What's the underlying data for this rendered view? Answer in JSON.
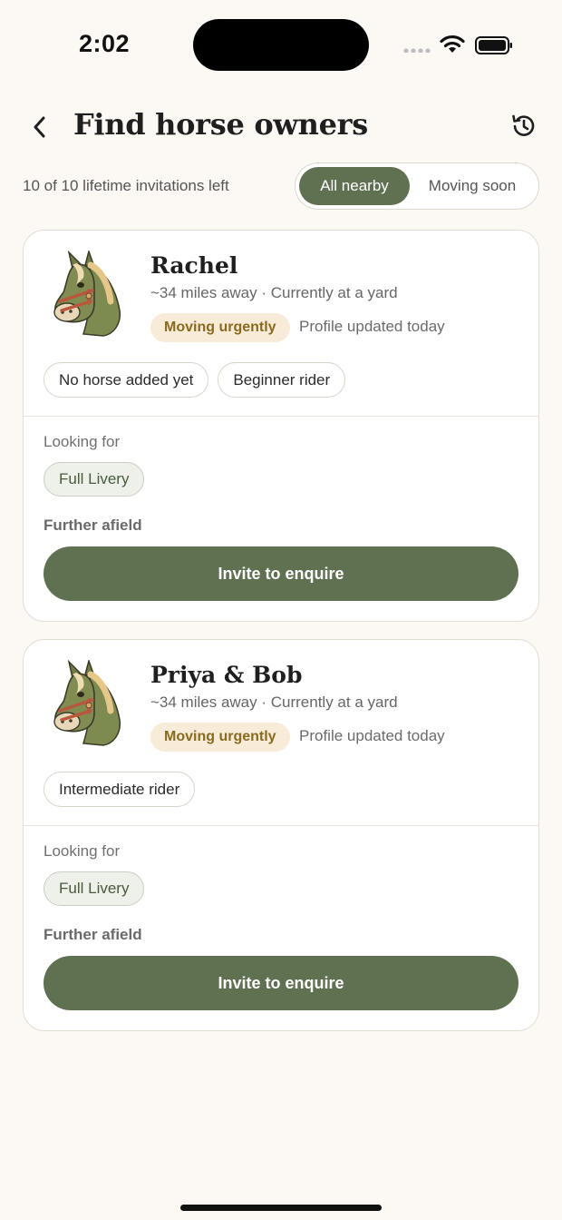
{
  "status_bar": {
    "time": "2:02",
    "icons": [
      "signal-icon",
      "wifi-icon",
      "battery-icon"
    ]
  },
  "header": {
    "title": "Find horse owners",
    "back_icon": "chevron-left-icon",
    "history_icon": "history-icon"
  },
  "controls": {
    "invites_left": "10 of 10 lifetime invitations left",
    "filters": [
      {
        "label": "All nearby",
        "selected": true
      },
      {
        "label": "Moving soon",
        "selected": false
      }
    ]
  },
  "colors": {
    "accent": "#5f7151",
    "background": "#fcf9f5",
    "badge_bg": "#f8ecd8",
    "badge_text": "#8a6a1f"
  },
  "owners": [
    {
      "name": "Rachel",
      "meta": "~34 miles away · Currently at a yard",
      "badge": "Moving urgently",
      "updated": "Profile updated today",
      "chips": [
        "No horse added yet",
        "Beginner rider"
      ],
      "looking_for_label": "Looking for",
      "looking_for": "Full Livery",
      "further_label": "Further afield",
      "cta": "Invite to enquire"
    },
    {
      "name": "Priya & Bob",
      "meta": "~34 miles away · Currently at a yard",
      "badge": "Moving urgently",
      "updated": "Profile updated today",
      "chips": [
        "Intermediate rider"
      ],
      "looking_for_label": "Looking for",
      "looking_for": "Full Livery",
      "further_label": "Further afield",
      "cta": "Invite to enquire"
    }
  ]
}
